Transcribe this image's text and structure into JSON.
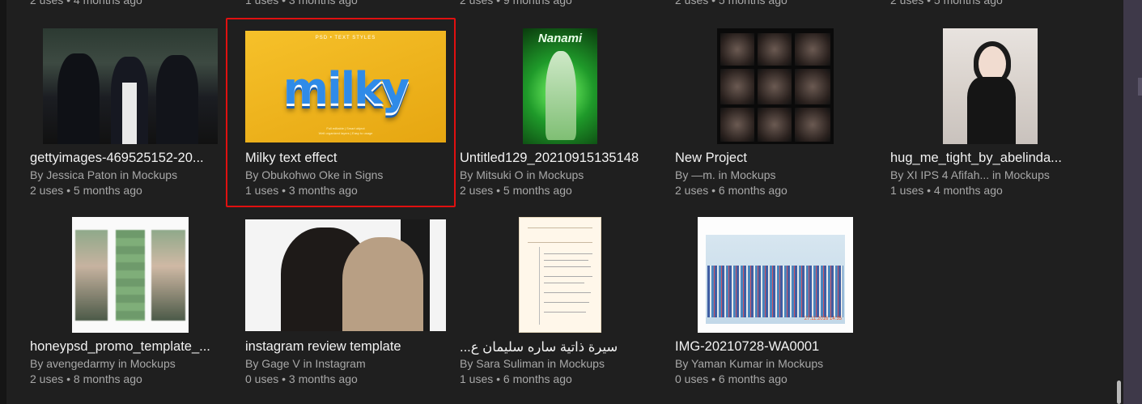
{
  "top_row_meta": [
    "2 uses • 4 months ago",
    "1 uses • 3 months ago",
    "2 uses • 9 months ago",
    "2 uses • 5 months ago",
    "2 uses • 5 months ago"
  ],
  "items": [
    {
      "title": "gettyimages-469525152-20...",
      "author": "By Jessica Paton in Mockups",
      "meta": "2 uses • 5 months ago",
      "thumb_icon": "photo-thumbnail"
    },
    {
      "title": "Milky text effect",
      "author": "By Obukohwo Oke in Signs",
      "meta": "1 uses • 3 months ago",
      "thumb_icon": "text-effect-thumbnail",
      "thumb_text": "milky",
      "thumb_top_text": "PSD • TEXT STYLES",
      "thumb_bottom_text": "Full editable | Smart object\nWell organized layers | Easy to usage",
      "selected": true
    },
    {
      "title": "Untitled129_20210915135148",
      "author": "By Mitsuki O in Mockups",
      "meta": "2 uses • 5 months ago",
      "thumb_icon": "artwork-thumbnail",
      "thumb_text": "Nanami"
    },
    {
      "title": "New Project",
      "author": "By —m. in Mockups",
      "meta": "2 uses • 6 months ago",
      "thumb_icon": "collage-thumbnail"
    },
    {
      "title": "hug_me_tight_by_abelinda...",
      "author": "By XI IPS 4 Afifah... in Mockups",
      "meta": "1 uses • 4 months ago",
      "thumb_icon": "photo-thumbnail"
    },
    {
      "title": "honeypsd_promo_template_...",
      "author": "By avengedarmy in Mockups",
      "meta": "2 uses • 8 months ago",
      "thumb_icon": "template-thumbnail"
    },
    {
      "title": "instagram review template",
      "author": "By Gage V in Instagram",
      "meta": "0 uses • 3 months ago",
      "thumb_icon": "photo-thumbnail"
    },
    {
      "title": "سيرة ذاتية ساره سليمان ع...",
      "author": "By Sara Suliman in Mockups",
      "meta": "1 uses • 6 months ago",
      "thumb_icon": "document-thumbnail"
    },
    {
      "title": "IMG-20210728-WA0001",
      "author": "By Yaman Kumar in Mockups",
      "meta": "0 uses • 6 months ago",
      "thumb_icon": "group-photo-thumbnail",
      "thumb_date": "27.11.2016 14:35"
    }
  ],
  "colors": {
    "background": "#1f1f1f",
    "selection": "#e01010",
    "title": "#f2f2f2",
    "meta": "#a8a8a8"
  }
}
